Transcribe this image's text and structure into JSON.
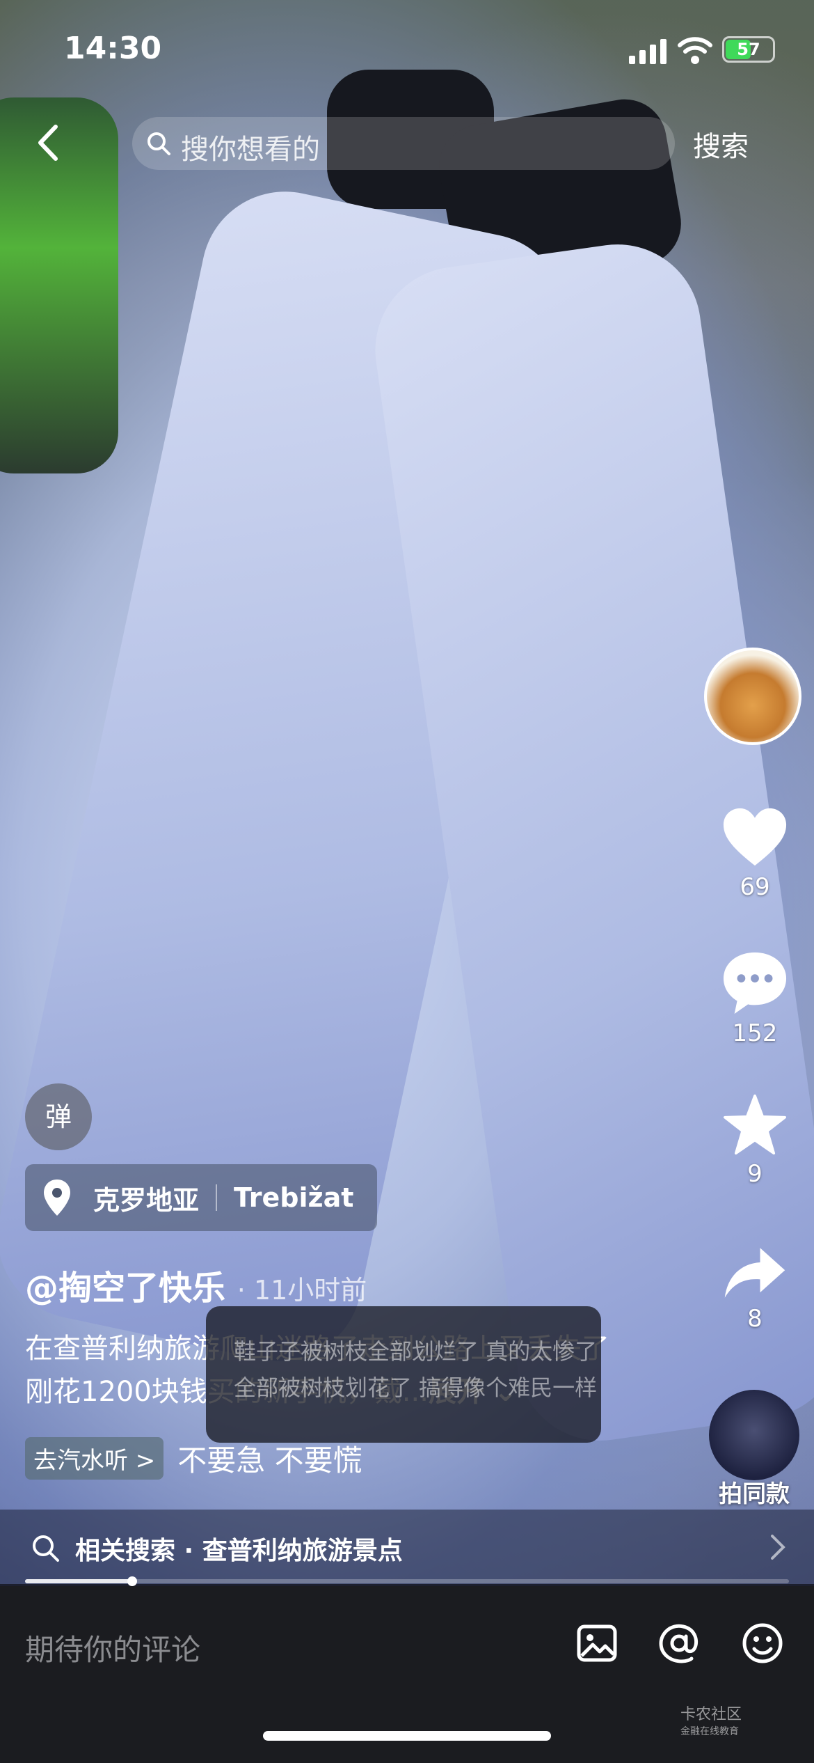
{
  "status_bar": {
    "time": "14:30",
    "battery": "57",
    "battery_level": 0.57
  },
  "top": {
    "search_placeholder": "搜你想看的",
    "search_button": "搜索"
  },
  "actions": {
    "likes": "69",
    "comments": "152",
    "favorites": "9",
    "shares": "8"
  },
  "danmu_label": "弹",
  "location": {
    "region": "克罗地亚",
    "place": "Trebižat"
  },
  "post": {
    "author": "@掏空了快乐",
    "time_ago": "· 11小时前",
    "description": "在查普利纳旅游爬山迷路了走到公路上又丢失了刚花1200块钱买的新手机，戴...",
    "expand_label": "展开"
  },
  "popup": {
    "line1": "鞋子子被树枝全部划烂了 真的太惨了",
    "line2": "全部被树枝划花了 搞得像个难民一样"
  },
  "music": {
    "tag": "去汽水听 >",
    "title": "不要急 不要慌"
  },
  "same_style_label": "拍同款",
  "related": {
    "text": "相关搜索 · 查普利纳旅游景点"
  },
  "progress": 0.14,
  "comment": {
    "placeholder": "期待你的评论"
  },
  "watermark": {
    "title": "卡农社区",
    "subtitle": "金融在线教育"
  },
  "colors": {
    "battery_green": "#3fd95a",
    "accent": "#ffffff"
  }
}
